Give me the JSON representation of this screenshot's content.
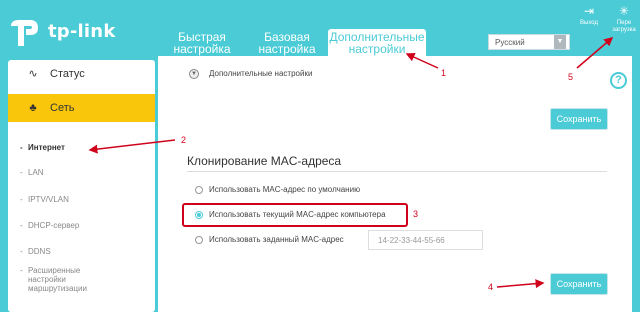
{
  "header": {
    "logo_text": "tp-link",
    "tabs": [
      {
        "line1": "Быстрая",
        "line2": "настройка"
      },
      {
        "line1": "Базовая",
        "line2": "настройка"
      },
      {
        "line1": "Дополнительные",
        "line2": "настройки"
      }
    ],
    "language": "Русский",
    "logout_label": "Выход",
    "reboot_label_1": "Пере",
    "reboot_label_2": "загрузка"
  },
  "sidebar": {
    "status": "Статус",
    "network": "Сеть",
    "sub_items": [
      "Интернет",
      "LAN",
      "IPTV/VLAN",
      "DHCP-сервер",
      "DDNS",
      "Расширенные",
      "настройки",
      "маршрутизации"
    ]
  },
  "main": {
    "advanced_label": "Дополнительные настройки",
    "save_label": "Сохранить",
    "section_title": "Клонирование MAC-адреса",
    "options": [
      "Использовать MAC-адрес по умолчанию",
      "Использовать текущий MAC-адрес компьютера",
      "Использовать заданный MAC-адрес"
    ],
    "selected_option": 1,
    "mac_placeholder": "14-22-33-44-55-66"
  },
  "annotations": [
    "1",
    "2",
    "3",
    "4",
    "5"
  ],
  "colors": {
    "accent": "#4acbd6",
    "active_menu": "#f9c60c",
    "annotation": "#d0021b"
  }
}
